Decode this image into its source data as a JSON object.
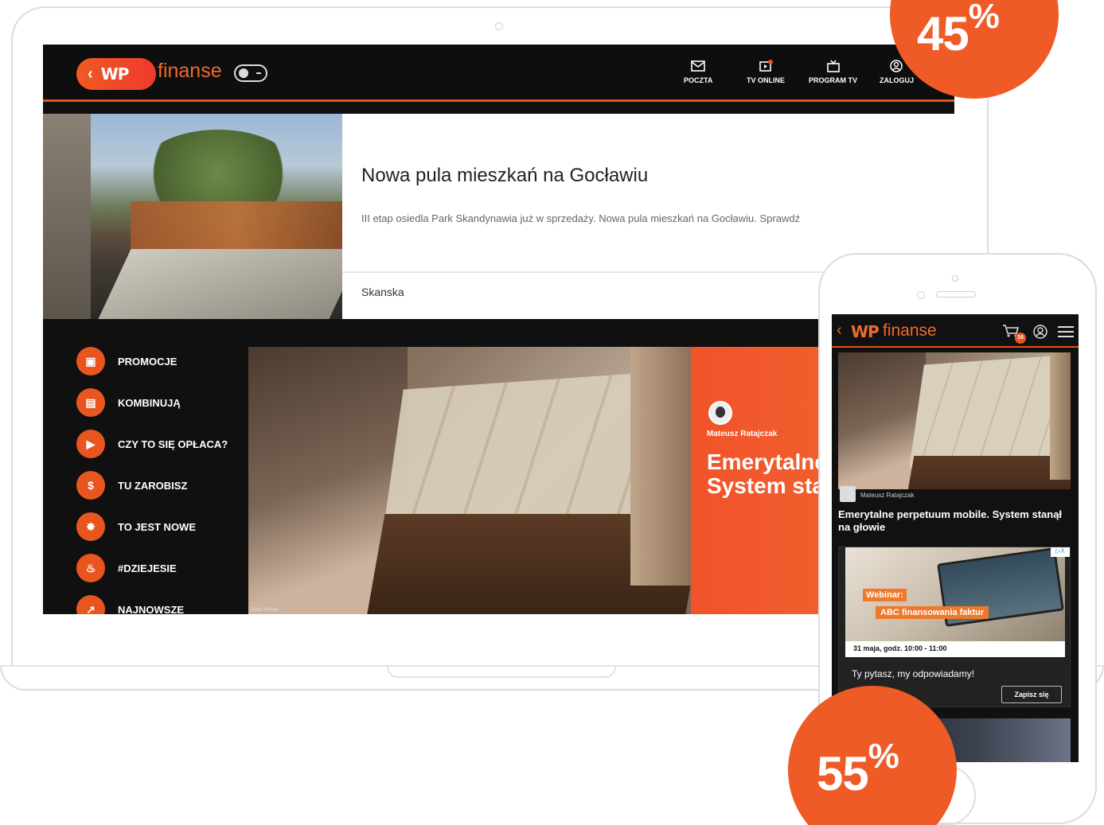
{
  "laptop": {
    "header": {
      "logo_back": "‹",
      "logo_wp": "WP",
      "brand": "finanse",
      "nav": [
        {
          "label": "POCZTA",
          "icon": "mail-icon"
        },
        {
          "label": "TV ONLINE",
          "icon": "tv-online-icon"
        },
        {
          "label": "PROGRAM TV",
          "icon": "tv-program-icon"
        },
        {
          "label": "ZALOGUJ",
          "icon": "user-icon"
        }
      ]
    },
    "hero": {
      "title": "Nowa pula mieszkań na Gocławiu",
      "description": "III etap osiedla Park Skandynawia już w sprzedaży. Nowa pula mieszkań na Gocławiu. Sprawdź",
      "source": "Skanska"
    },
    "sidebar": [
      {
        "label": "PROMOCJE",
        "icon": "wallet-icon"
      },
      {
        "label": "KOMBINUJĄ",
        "icon": "briefcase-icon"
      },
      {
        "label": "CZY TO SIĘ OPŁACA?",
        "icon": "video-icon"
      },
      {
        "label": "TU ZAROBISZ",
        "icon": "dollar-icon"
      },
      {
        "label": "TO JEST NOWE",
        "icon": "new-badge-icon"
      },
      {
        "label": "#DZIEJESIE",
        "icon": "fire-icon"
      },
      {
        "label": "NAJNOWSZE",
        "icon": "trend-up-icon"
      }
    ],
    "feature": {
      "author": "Mateusz Ratajczak",
      "headline": "Emerytalne perpetuum System sta głowie",
      "image_credit": "East News"
    }
  },
  "phone": {
    "header": {
      "back": "‹",
      "wp": "WP",
      "brand": "finanse",
      "cart_badge": "16"
    },
    "article": {
      "author": "Mateusz Ratajczak",
      "headline": "Emerytalne perpetuum mobile. System stanął na głowie"
    },
    "ad": {
      "tag1": "Webinar:",
      "tag2": "ABC finansowania faktur",
      "date": "31 maja, godz. 10:00 - 11:00",
      "text": "Ty pytasz, my odpowiadamy!",
      "button": "Zapisz się",
      "adchoices": "▷X"
    }
  },
  "badges": {
    "top": {
      "value": "45",
      "unit": "%"
    },
    "bottom": {
      "value": "55",
      "unit": "%"
    }
  },
  "colors": {
    "accent": "#ef5b26",
    "header_bg": "#0e0e0e",
    "text_dark": "#222222"
  }
}
